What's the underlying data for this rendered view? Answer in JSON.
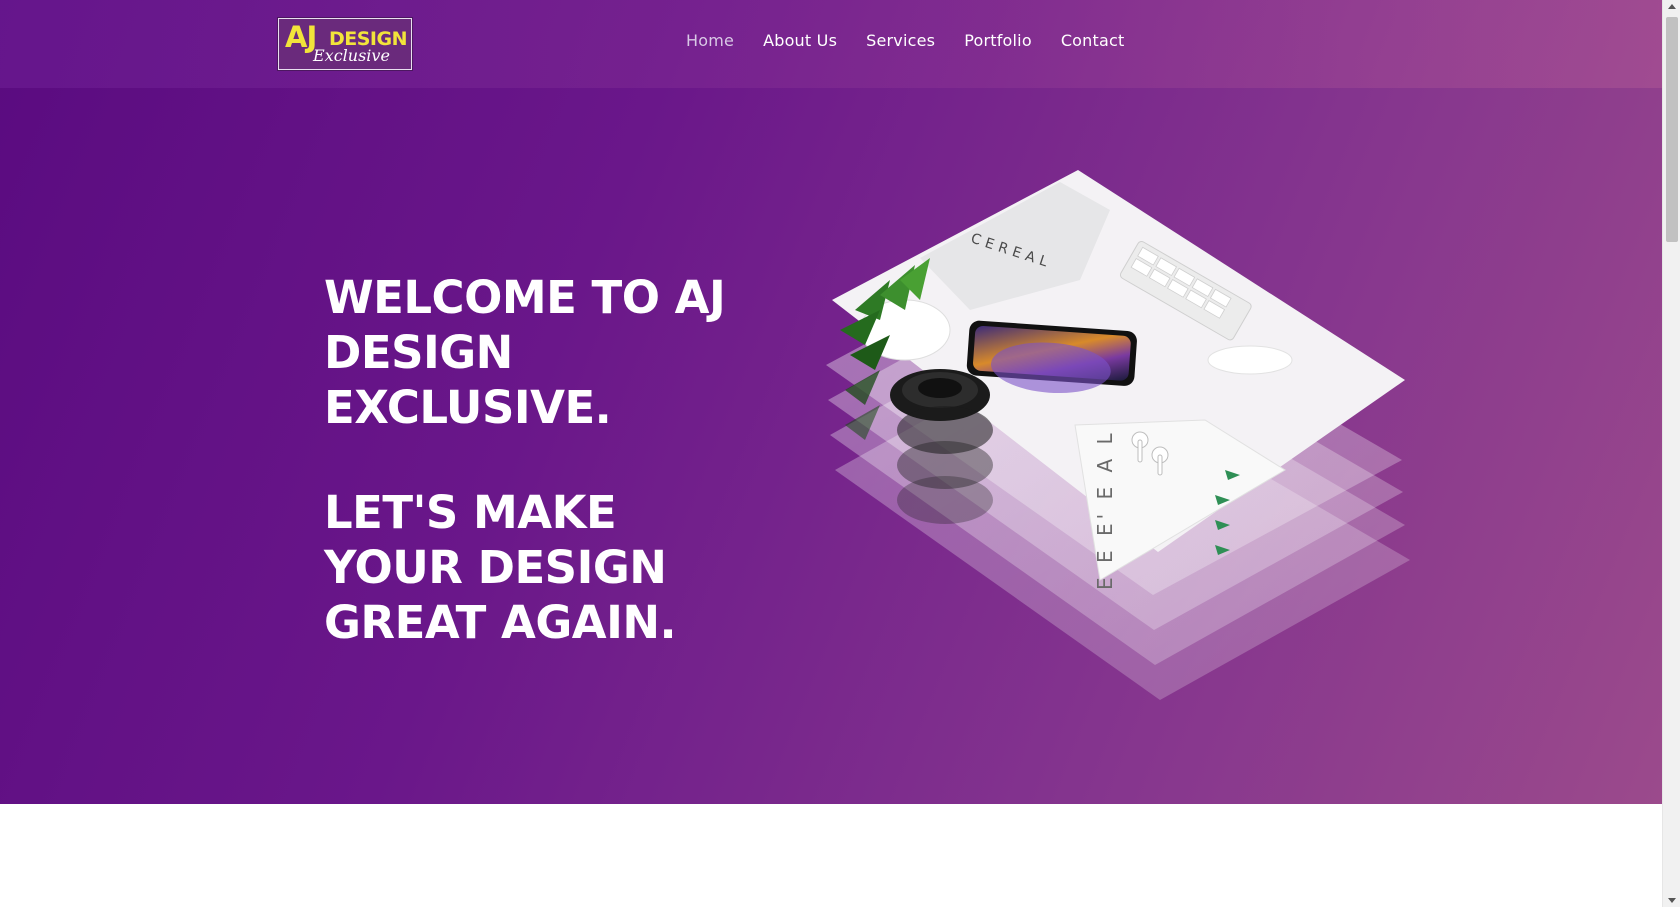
{
  "brand": {
    "logo_primary": "AJ",
    "logo_secondary": "DESIGN",
    "logo_script": "Exclusive"
  },
  "nav": {
    "items": [
      {
        "label": "Home",
        "active": true
      },
      {
        "label": "About Us",
        "active": false
      },
      {
        "label": "Services",
        "active": false
      },
      {
        "label": "Portfolio",
        "active": false
      },
      {
        "label": "Contact",
        "active": false
      }
    ]
  },
  "hero": {
    "headline_lines": [
      "WELCOME TO AJ",
      "DESIGN",
      "EXCLUSIVE."
    ],
    "tagline_lines": [
      "LET'S MAKE",
      "YOUR DESIGN",
      "GREAT AGAIN."
    ],
    "illustration_text": "CEREAL",
    "illustration_side_text": "E E E' E A L"
  },
  "colors": {
    "hero_gradient_start": "#5a0b80",
    "hero_gradient_end": "#9b4a8c",
    "logo_yellow": "#f2e43a",
    "text_white": "#ffffff"
  },
  "icons": {
    "scroll_up": "scroll-up-arrow-icon",
    "scroll_down": "scroll-down-arrow-icon"
  }
}
